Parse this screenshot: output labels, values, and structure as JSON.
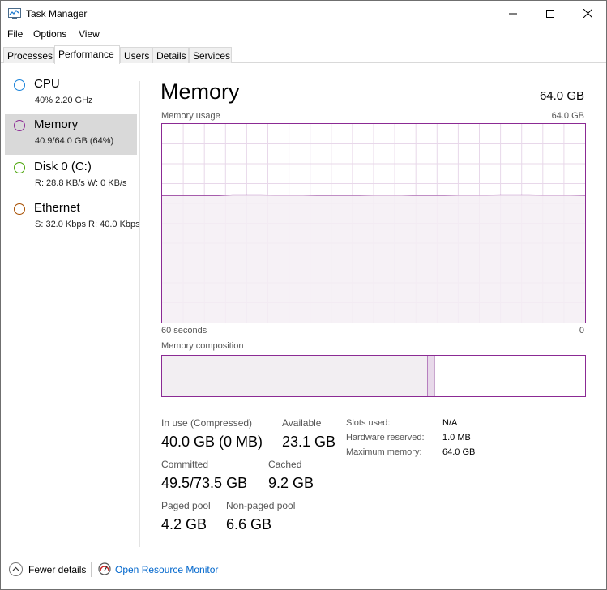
{
  "window": {
    "title": "Task Manager",
    "controls": {
      "minimize": "minimize-icon",
      "maximize": "maximize-icon",
      "close": "close-icon"
    }
  },
  "menu": [
    "File",
    "Options",
    "View"
  ],
  "tabs": [
    "Processes",
    "Performance",
    "Users",
    "Details",
    "Services"
  ],
  "active_tab": "Performance",
  "resources": [
    {
      "title": "CPU",
      "sub": "40%  2.20 GHz",
      "color": "#1a82d9"
    },
    {
      "title": "Memory",
      "sub": "40.9/64.0 GB (64%)",
      "color": "#8b2a94"
    },
    {
      "title": "Disk 0 (C:)",
      "sub": "R: 28.8 KB/s  W: 0 KB/s",
      "color": "#4da60c"
    },
    {
      "title": "Ethernet",
      "sub": "S: 32.0 Kbps  R: 40.0 Kbps",
      "color": "#a74f01"
    }
  ],
  "selected_resource": "Memory",
  "memory": {
    "title": "Memory",
    "total": "64.0 GB",
    "usage_label": "Memory usage",
    "usage_max": "64.0 GB",
    "time_left": "60 seconds",
    "time_right": "0",
    "composition_label": "Memory composition",
    "usage_fraction_history": [
      0.64,
      0.64,
      0.64,
      0.64,
      0.64,
      0.643,
      0.643,
      0.643,
      0.642,
      0.642,
      0.642,
      0.641,
      0.641,
      0.641,
      0.641,
      0.642,
      0.642,
      0.642,
      0.641,
      0.641,
      0.641,
      0.642,
      0.642,
      0.642,
      0.643,
      0.643,
      0.643,
      0.642,
      0.642,
      0.642,
      0.641
    ],
    "composition_fractions": {
      "in_use": 0.627,
      "modified": 0.017,
      "standby": 0.128,
      "free": 0.228
    },
    "stats": {
      "in_use_label": "In use (Compressed)",
      "in_use_value": "40.0 GB (0 MB)",
      "available_label": "Available",
      "available_value": "23.1 GB",
      "committed_label": "Committed",
      "committed_value": "49.5/73.5 GB",
      "cached_label": "Cached",
      "cached_value": "9.2 GB",
      "paged_label": "Paged pool",
      "paged_value": "4.2 GB",
      "nonpaged_label": "Non-paged pool",
      "nonpaged_value": "6.6 GB"
    },
    "details": {
      "slots_label": "Slots used:",
      "slots_value": "N/A",
      "hw_label": "Hardware reserved:",
      "hw_value": "1.0 MB",
      "max_label": "Maximum memory:",
      "max_value": "64.0 GB"
    }
  },
  "footer": {
    "fewer_details": "Fewer details",
    "open_monitor": "Open Resource Monitor"
  },
  "colors": {
    "memory_accent": "#8b2a94",
    "memory_fill": "#f4eef4",
    "grid": "#e8d8ea"
  }
}
